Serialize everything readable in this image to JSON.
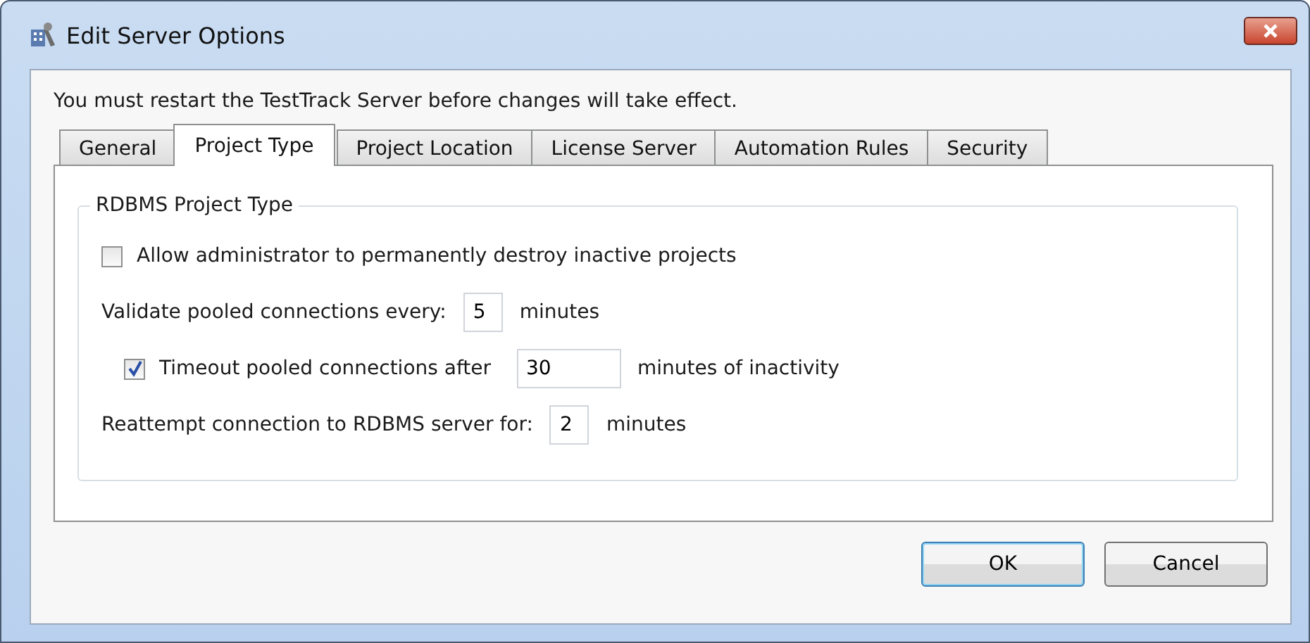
{
  "window": {
    "title": "Edit Server Options"
  },
  "notice": "You must restart the TestTrack Server before changes will take effect.",
  "tabs": [
    {
      "label": "General",
      "selected": false
    },
    {
      "label": "Project Type",
      "selected": true
    },
    {
      "label": "Project Location",
      "selected": false
    },
    {
      "label": "License Server",
      "selected": false
    },
    {
      "label": "Automation Rules",
      "selected": false
    },
    {
      "label": "Security",
      "selected": false
    }
  ],
  "group": {
    "title": "RDBMS Project Type",
    "rows": [
      {
        "kind": "checkbox",
        "label": "Allow administrator to permanently destroy inactive projects",
        "checked": false
      },
      {
        "kind": "field",
        "label": "Validate pooled connections every:",
        "value": "5",
        "suffix": "minutes"
      },
      {
        "kind": "checkfield",
        "label": "Timeout pooled connections after",
        "checked": true,
        "value": "30",
        "suffix": "minutes of inactivity"
      },
      {
        "kind": "field",
        "label": "Reattempt connection to RDBMS server for:",
        "value": "2",
        "suffix": "minutes"
      }
    ]
  },
  "buttons": [
    {
      "label": "OK",
      "default": true
    },
    {
      "label": "Cancel",
      "default": false
    }
  ]
}
